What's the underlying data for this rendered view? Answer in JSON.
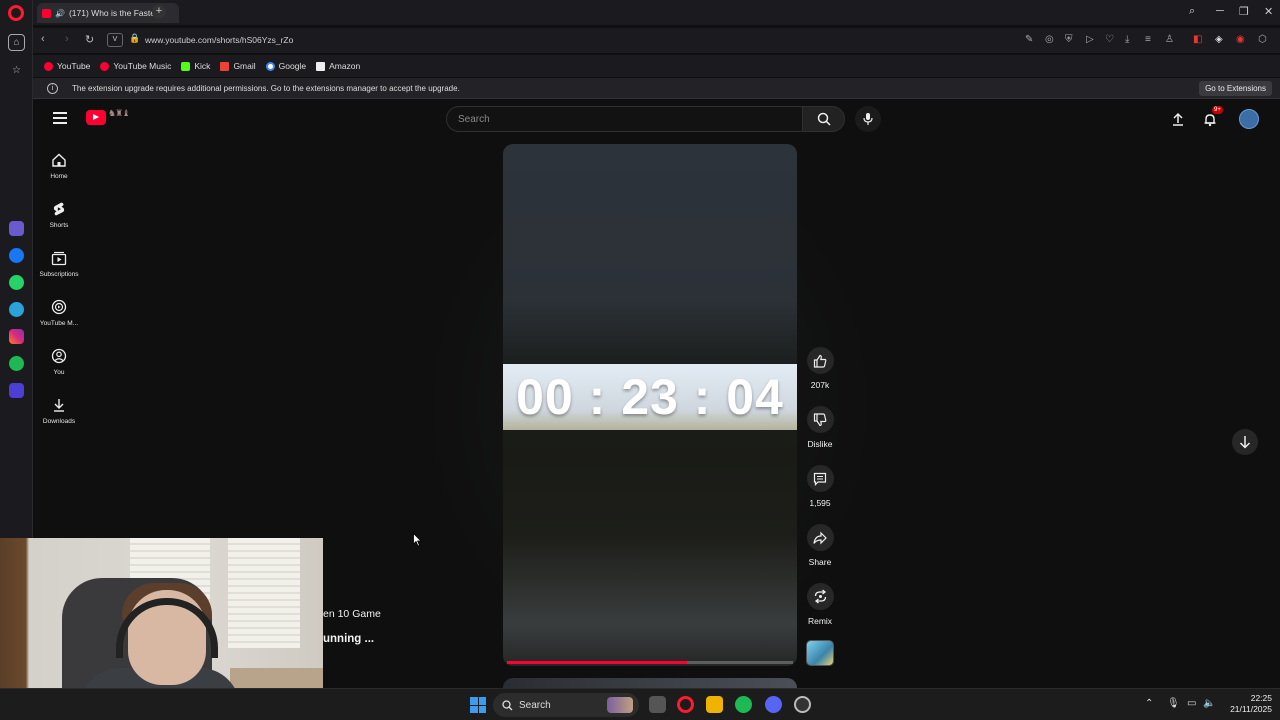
{
  "browser": {
    "tab_title": "(171) Who is the Faste",
    "url": "www.youtube.com/shorts/hS06Yzs_rZo",
    "url_prefix_pill": "V",
    "bookmarks": [
      {
        "label": "YouTube",
        "color": "#ff0033"
      },
      {
        "label": "YouTube Music",
        "color": "#ff0033"
      },
      {
        "label": "Kick",
        "color": "#53fc18"
      },
      {
        "label": "Gmail",
        "color": "#ea4335"
      },
      {
        "label": "Google",
        "color": "#4285f4"
      },
      {
        "label": "Amazon",
        "color": "#ff9900"
      }
    ],
    "notice": {
      "text": "The extension upgrade requires additional permissions. Go to the extensions manager to accept the upgrade.",
      "button": "Go to Extensions"
    }
  },
  "youtube": {
    "search_placeholder": "Search",
    "notification_count": "9+",
    "guide": [
      {
        "label": "Home",
        "icon": "home-icon"
      },
      {
        "label": "Shorts",
        "icon": "shorts-icon"
      },
      {
        "label": "Subscriptions",
        "icon": "subscriptions-icon"
      },
      {
        "label": "YouTube M...",
        "icon": "youtube-music-icon"
      },
      {
        "label": "You",
        "icon": "you-icon"
      },
      {
        "label": "Downloads",
        "icon": "download-icon"
      }
    ],
    "short": {
      "timer_text": "00 : 23 : 04",
      "progress_fraction": 0.63,
      "title_fragment_1": "en 10 Game",
      "title_fragment_2": "unning ..."
    },
    "actions": {
      "like_count": "207k",
      "dislike_label": "Dislike",
      "comment_count": "1,595",
      "share_label": "Share",
      "remix_label": "Remix"
    },
    "accent_color": "#ff0033"
  },
  "taskbar": {
    "search_label": "Search",
    "time": "22:25",
    "date": "21/11/2025"
  }
}
